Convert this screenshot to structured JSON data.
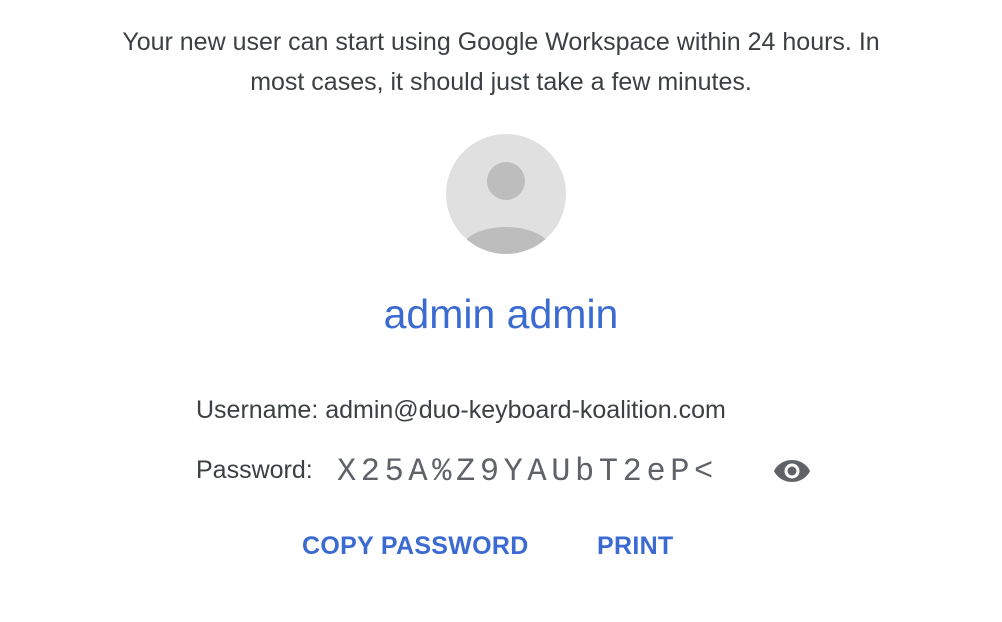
{
  "intro": {
    "line1": "Your new user can start using Google Workspace within 24 hours. In",
    "line2": "most cases, it should just take a few minutes."
  },
  "user": {
    "display_name": "admin admin",
    "avatar_icon": "default-avatar-icon",
    "username_label": "Username:",
    "username": "admin@duo-keyboard-koalition.com",
    "password_label": "Password:",
    "password": "X25A%Z9YAUbT2eP<",
    "show_password_icon": "eye-icon"
  },
  "actions": {
    "copy_password": "COPY PASSWORD",
    "print": "PRINT"
  },
  "colors": {
    "accent": "#3b6bd1",
    "text": "#3c4043",
    "avatar_bg": "#e0e0e0",
    "avatar_fg": "#bdbdbd",
    "icon": "#5f6368"
  }
}
